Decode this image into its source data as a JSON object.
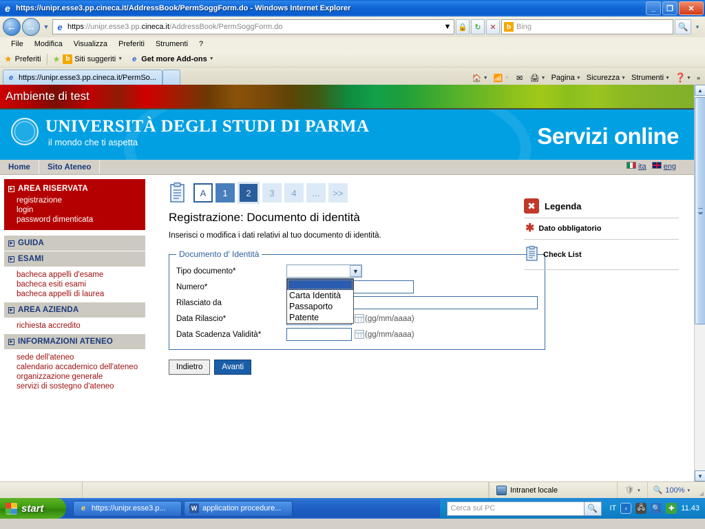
{
  "window": {
    "title": "https://unipr.esse3.pp.cineca.it/AddressBook/PermSoggForm.do - Windows Internet Explorer",
    "minimize_label": "_",
    "restore_label": "❐",
    "close_label": "✕"
  },
  "browser": {
    "back_label": "←",
    "forward_label": "→",
    "history_caret": "▼",
    "url_scheme": "https",
    "url_rest": "://unipr.esse3.pp.",
    "url_host": "cineca.it",
    "url_path": "/AddressBook/PermSoggForm.do",
    "url_full": "https://unipr.esse3.pp.cineca.it/AddressBook/PermSoggForm.do",
    "compat_label": "▼",
    "lock_label": "🔒",
    "refresh_label": "↻",
    "stop_label": "✕",
    "search_engine": "b",
    "search_placeholder": "Bing",
    "search_go_label": "🔍",
    "search_caret": "▾",
    "menu": [
      "File",
      "Modifica",
      "Visualizza",
      "Preferiti",
      "Strumenti",
      "?"
    ],
    "favorites": {
      "favorites_label": "Preferiti",
      "suggested_label": "Siti suggeriti",
      "addons_label": "Get more Add-ons"
    },
    "tab_label": "https://unipr.esse3.pp.cineca.it/PermSo...",
    "commands": {
      "home": "Home",
      "feeds": "Feed",
      "mail": "Posta",
      "print": "Stampa",
      "page": "Pagina",
      "safety": "Sicurezza",
      "tools": "Strumenti",
      "help": "?",
      "overflow": "»"
    }
  },
  "page": {
    "test_banner": "Ambiente di test",
    "university": "UNIVERSITÀ DEGLI STUDI DI PARMA",
    "tagline": "il mondo che ti aspetta",
    "services": "Servizi online",
    "nav": [
      "Home",
      "Sito Ateneo"
    ],
    "languages": [
      {
        "code": "ita"
      },
      {
        "code": "eng"
      }
    ],
    "steps": [
      {
        "label": "A",
        "state": "current-outline"
      },
      {
        "label": "1",
        "state": "done"
      },
      {
        "label": "2",
        "state": "active"
      },
      {
        "label": "3",
        "state": "future"
      },
      {
        "label": "4",
        "state": "future"
      },
      {
        "label": "...",
        "state": "future"
      },
      {
        "label": ">>",
        "state": "future"
      }
    ],
    "heading": "Registrazione: Documento di identità",
    "lead": "Inserisci o modifica i dati relativi al tuo documento di identità.",
    "form": {
      "legend": "Documento d' Identità",
      "fields": [
        {
          "label": "Tipo documento*",
          "value": "",
          "type": "select"
        },
        {
          "label": "Numero*",
          "value": "",
          "type": "text"
        },
        {
          "label": "Rilasciato da",
          "value": "",
          "type": "text"
        },
        {
          "label": "Data Rilascio*",
          "value": "",
          "type": "date",
          "hint": "(gg/mm/aaaa)"
        },
        {
          "label": "Data Scadenza Validità*",
          "value": "",
          "type": "date",
          "hint": "(gg/mm/aaaa)"
        }
      ],
      "select_options": [
        "",
        "Carta Identità",
        "Passaporto",
        "Patente"
      ],
      "select_selected_index": 0
    },
    "buttons": {
      "back": "Indietro",
      "next": "Avanti"
    },
    "legend_panel": {
      "title": "Legenda",
      "rows": [
        {
          "icon": "asterisk-icon",
          "label": "Dato obbligatorio"
        },
        {
          "icon": "checklist-icon",
          "label": "Check List"
        }
      ]
    },
    "sidebar": [
      {
        "type": "red",
        "title": "AREA RISERVATA",
        "links": [
          "registrazione",
          "login",
          "password dimenticata"
        ]
      },
      {
        "type": "gray",
        "title": "GUIDA",
        "links": []
      },
      {
        "type": "gray",
        "title": "ESAMI",
        "links": [
          "bacheca appelli d'esame",
          "bacheca esiti esami",
          "bacheca appelli di laurea"
        ]
      },
      {
        "type": "gray",
        "title": "AREA AZIENDA",
        "links": [
          "richiesta accredito"
        ]
      },
      {
        "type": "gray",
        "title": "INFORMAZIONI ATENEO",
        "links": [
          "sede dell'ateneo",
          "calendario accademico dell'ateneo",
          "organizzazione generale",
          "servizi di sostegno d'ateneo"
        ]
      }
    ]
  },
  "statusbar": {
    "zone": "Intranet locale",
    "zoom": "100%",
    "zoom_caret": "▾",
    "protected_caret": "▾"
  },
  "taskbar": {
    "start": "start",
    "items": [
      {
        "label": "https://unipr.esse3.p...",
        "icon": "ie-icon"
      },
      {
        "label": "application procedure...",
        "icon": "word-icon"
      }
    ],
    "desktop_search_placeholder": "Cerca sul PC",
    "desktop_search_go": "🔍",
    "language": "IT",
    "clock": "11.43"
  }
}
